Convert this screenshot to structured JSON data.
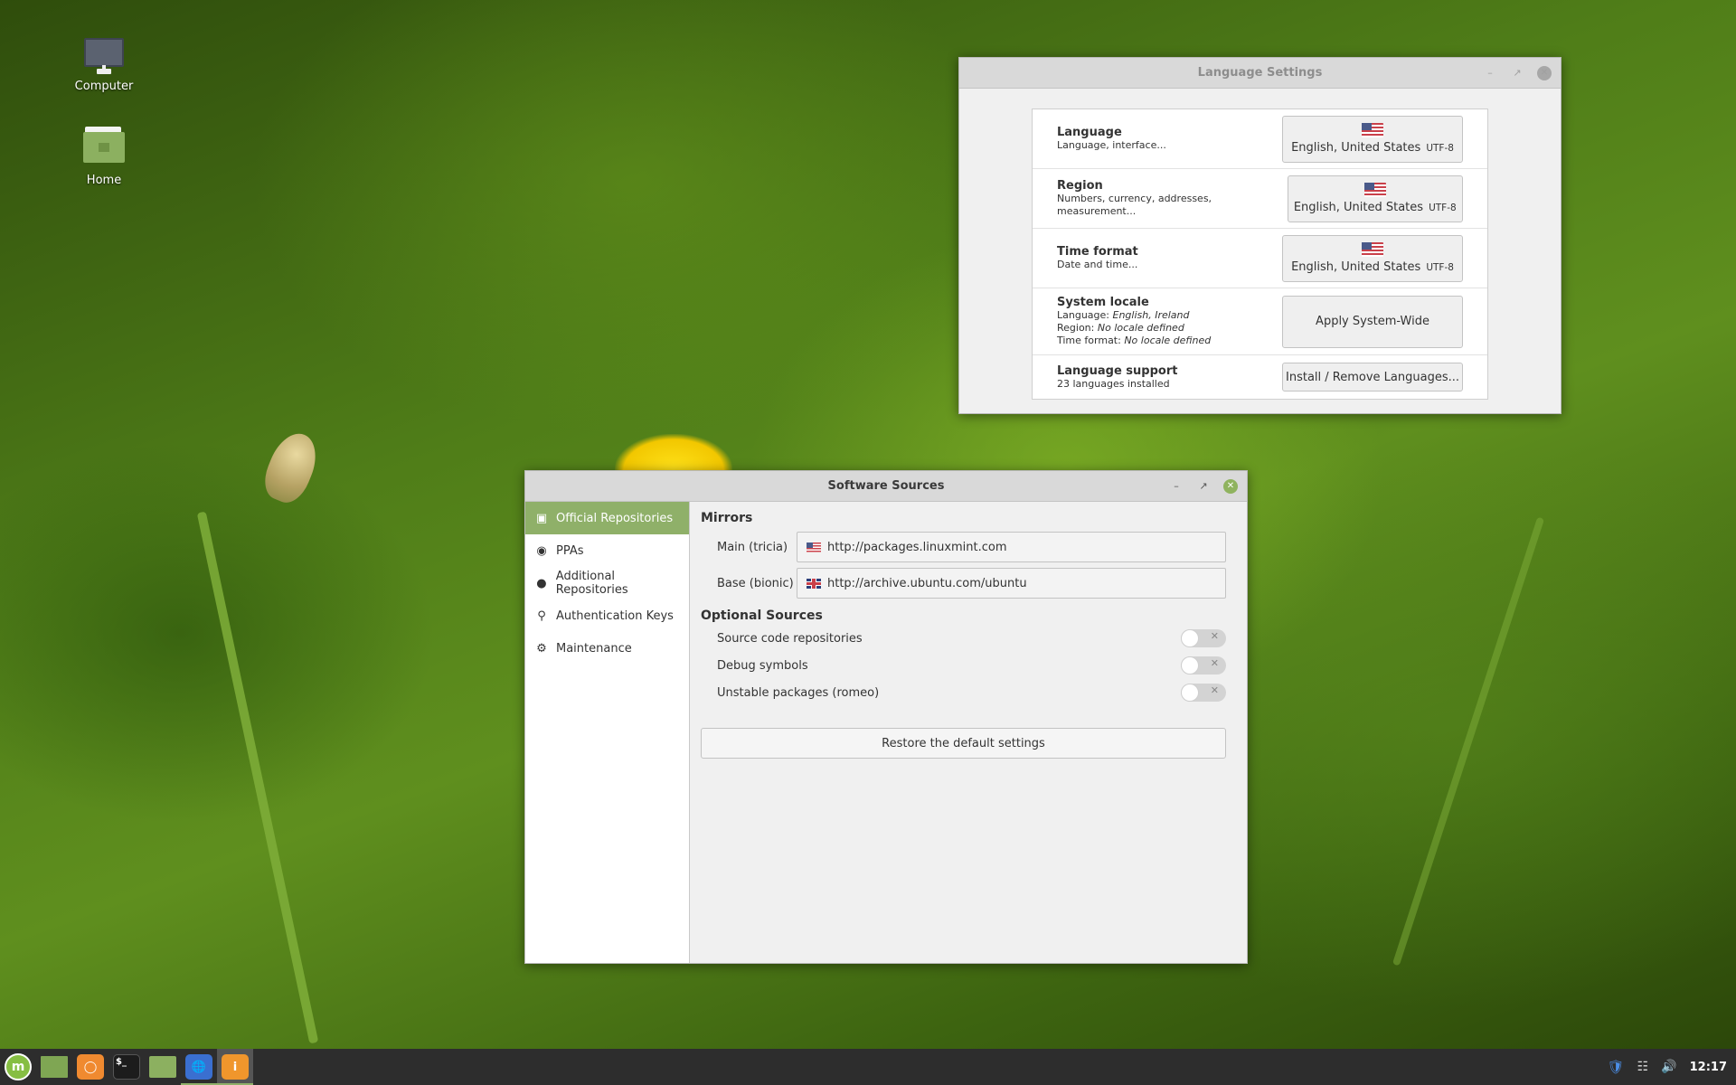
{
  "desktop": {
    "icons": [
      {
        "label": "Computer",
        "icon": "computer-icon"
      },
      {
        "label": "Home",
        "icon": "home-folder-icon"
      }
    ]
  },
  "language_window": {
    "title": "Language Settings",
    "rows": [
      {
        "title": "Language",
        "subtitle": "Language, interface...",
        "button_value": "English, United States",
        "button_encoding": "UTF-8"
      },
      {
        "title": "Region",
        "subtitle": "Numbers, currency, addresses, measurement...",
        "button_value": "English, United States",
        "button_encoding": "UTF-8"
      },
      {
        "title": "Time format",
        "subtitle": "Date and time...",
        "button_value": "English, United States",
        "button_encoding": "UTF-8"
      }
    ],
    "system_locale": {
      "title": "System locale",
      "language_label": "Language:",
      "language_value": "English, Ireland",
      "region_label": "Region:",
      "region_value": "No locale defined",
      "time_label": "Time format:",
      "time_value": "No locale defined",
      "button": "Apply System-Wide"
    },
    "language_support": {
      "title": "Language support",
      "subtitle": "23 languages installed",
      "button": "Install / Remove Languages..."
    }
  },
  "software_window": {
    "title": "Software Sources",
    "sidebar": [
      {
        "label": "Official Repositories",
        "icon": "package-icon",
        "active": true
      },
      {
        "label": "PPAs",
        "icon": "ppa-icon",
        "active": false
      },
      {
        "label": "Additional Repositories",
        "icon": "globe-icon",
        "active": false
      },
      {
        "label": "Authentication Keys",
        "icon": "key-icon",
        "active": false
      },
      {
        "label": "Maintenance",
        "icon": "maintenance-icon",
        "active": false
      }
    ],
    "mirrors_title": "Mirrors",
    "mirrors": [
      {
        "label": "Main (tricia)",
        "url": "http://packages.linuxmint.com",
        "flag": "us-flag"
      },
      {
        "label": "Base (bionic)",
        "url": "http://archive.ubuntu.com/ubuntu",
        "flag": "uk-flag"
      }
    ],
    "optional_title": "Optional Sources",
    "optional": [
      {
        "label": "Source code repositories",
        "enabled": false
      },
      {
        "label": "Debug symbols",
        "enabled": false
      },
      {
        "label": "Unstable packages (romeo)",
        "enabled": false
      }
    ],
    "restore_button": "Restore the default settings"
  },
  "panel": {
    "launchers": [
      "menu",
      "show-desktop",
      "firefox",
      "terminal",
      "files",
      "language-settings",
      "software-sources"
    ],
    "terminal_glyph": "$_",
    "clock": "12:17"
  },
  "colors": {
    "accent": "#8fb069",
    "panel": "#2d2d2d"
  }
}
